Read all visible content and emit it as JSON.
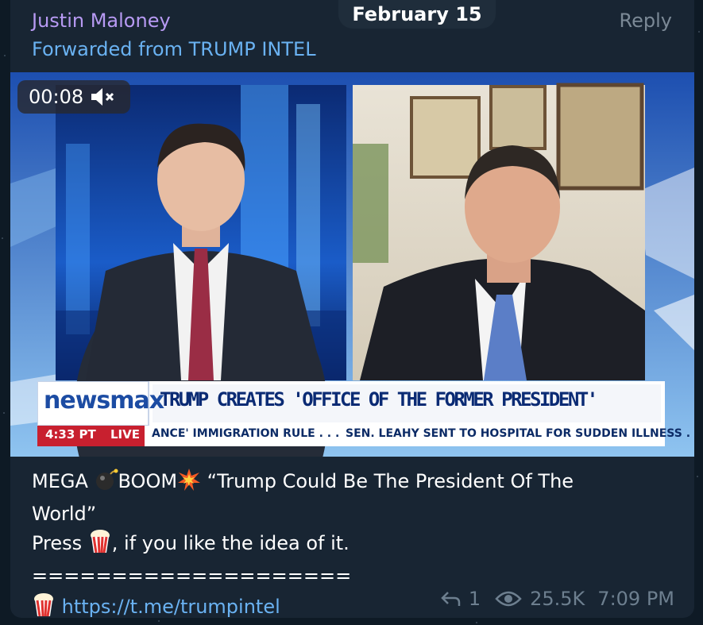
{
  "message": {
    "sender": "Justin Maloney",
    "forwarded_from": "Forwarded from TRUMP INTEL",
    "date_pill": "February 15",
    "reply_label": "Reply",
    "video": {
      "duration": "00:08",
      "network": "newsmax",
      "headline": "TRUMP CREATES 'OFFICE OF THE FORMER PRESIDENT'",
      "clock": "4:33 PT",
      "live": "LIVE",
      "ticker_1": "ANCE' IMMIGRATION RULE . . .",
      "ticker_2": "SEN. LEAHY SENT TO HOSPITAL FOR SUDDEN ILLNESS ."
    },
    "caption": {
      "line1": "MEGA ",
      "line1b": "BOOM",
      "line1c": " “Trump Could Be The President Of The",
      "line2": "World”",
      "line3a": "Press ",
      "line3b": ", if you like the idea of it.",
      "separator": "====================",
      "link": "https://t.me/trumpintel"
    },
    "replies": "1",
    "views": "25.5K",
    "time": "7:09 PM",
    "icons": [
      "muted-speaker-icon",
      "bomb-emoji",
      "collision-emoji",
      "popcorn-emoji",
      "reply-arrow-icon",
      "eye-icon"
    ]
  }
}
